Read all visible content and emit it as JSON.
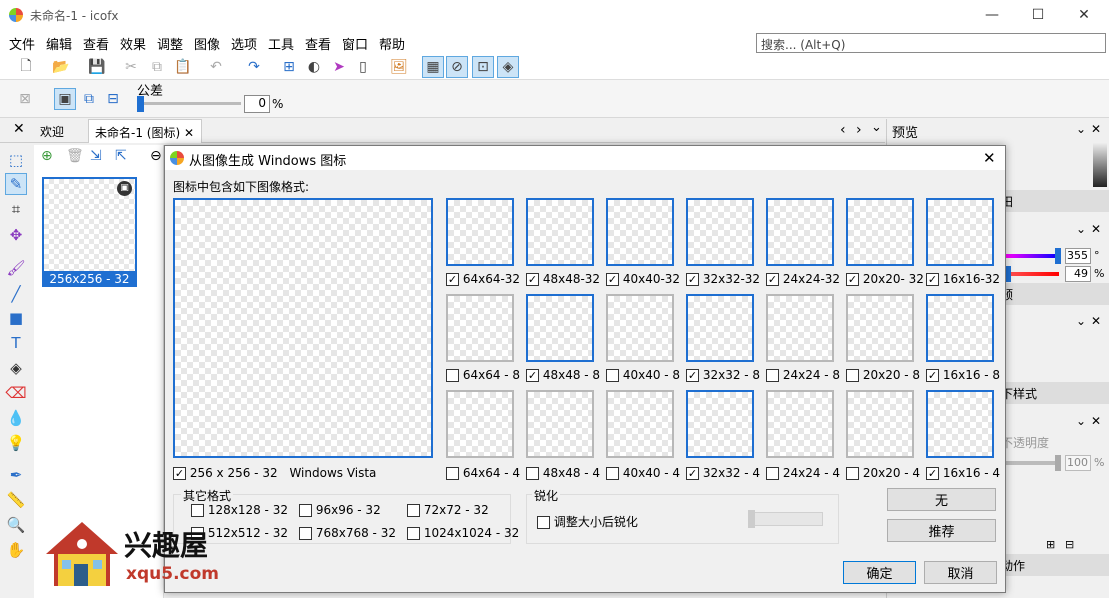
{
  "window": {
    "title": "未命名-1 - icofx",
    "min": "—",
    "max": "☐",
    "close": "✕"
  },
  "menu": [
    "文件",
    "编辑",
    "查看",
    "效果",
    "调整",
    "图像",
    "选项",
    "工具",
    "查看",
    "窗口",
    "帮助"
  ],
  "search": {
    "placeholder": "搜索... (Alt+Q)"
  },
  "options": {
    "tolerance_label": "公差",
    "tolerance_value": "0",
    "tolerance_unit": "%"
  },
  "tabs": [
    {
      "label": "欢迎"
    },
    {
      "label": "未命名-1 (图标)"
    }
  ],
  "tab_nav": {
    "prev": "‹",
    "next": "›",
    "menu": "⌄"
  },
  "thumbnail": {
    "label": "256x256 - 32"
  },
  "right_panel": {
    "preview_title": "预览",
    "frag1": "田",
    "value1": "355",
    "unit1": "°",
    "value2": "49",
    "unit2": "%",
    "frag2": "预",
    "frag3": "下样式",
    "frag4": "不透明度",
    "value3": "100",
    "unit3": "%",
    "frag5": "动作"
  },
  "dialog": {
    "title": "从图像生成 Windows 图标",
    "close": "✕",
    "section_label": "图标中包含如下图像格式:",
    "large": {
      "label": "256 x 256 - 32",
      "extra": "Windows Vista",
      "checked": true
    },
    "grid": [
      [
        {
          "label": "64x64-32",
          "checked": true,
          "sel": true
        },
        {
          "label": "48x48-32",
          "checked": true,
          "sel": true
        },
        {
          "label": "40x40-32",
          "checked": true,
          "sel": true
        },
        {
          "label": "32x32-32",
          "checked": true,
          "sel": true
        },
        {
          "label": "24x24-32",
          "checked": true,
          "sel": true
        },
        {
          "label": "20x20- 32",
          "checked": true,
          "sel": true
        },
        {
          "label": "16x16-32",
          "checked": true,
          "sel": true
        }
      ],
      [
        {
          "label": "64x64 - 8",
          "checked": false,
          "sel": false
        },
        {
          "label": "48x48 - 8",
          "checked": true,
          "sel": true
        },
        {
          "label": "40x40 - 8",
          "checked": false,
          "sel": false
        },
        {
          "label": "32x32 - 8",
          "checked": true,
          "sel": true
        },
        {
          "label": "24x24 - 8",
          "checked": false,
          "sel": false
        },
        {
          "label": "20x20 - 8",
          "checked": false,
          "sel": false
        },
        {
          "label": "16x16 - 8",
          "checked": true,
          "sel": true
        }
      ],
      [
        {
          "label": "64x64 - 4",
          "checked": false,
          "sel": false
        },
        {
          "label": "48x48 - 4",
          "checked": false,
          "sel": false
        },
        {
          "label": "40x40 - 4",
          "checked": false,
          "sel": false
        },
        {
          "label": "32x32 - 4",
          "checked": true,
          "sel": true
        },
        {
          "label": "24x24 - 4",
          "checked": false,
          "sel": false
        },
        {
          "label": "20x20 - 4",
          "checked": false,
          "sel": false
        },
        {
          "label": "16x16 - 4",
          "checked": true,
          "sel": true
        }
      ]
    ],
    "other_formats": {
      "title": "其它格式",
      "items": [
        {
          "label": "128x128 - 32"
        },
        {
          "label": "96x96 - 32"
        },
        {
          "label": "72x72 - 32"
        },
        {
          "label": "512x512 - 32"
        },
        {
          "label": "768x768 - 32"
        },
        {
          "label": "1024x1024 - 32"
        }
      ]
    },
    "sharpen": {
      "title": "锐化",
      "option": "调整大小后锐化"
    },
    "buttons": {
      "none": "无",
      "recommend": "推荐",
      "ok": "确定",
      "cancel": "取消"
    }
  },
  "watermark": {
    "name": "兴趣屋",
    "url": "xqu5.com"
  }
}
